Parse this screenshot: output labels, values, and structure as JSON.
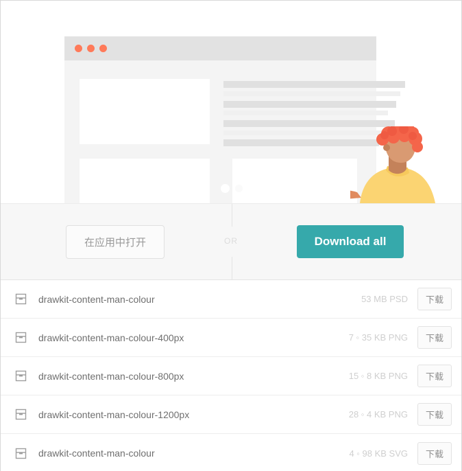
{
  "preview": {
    "illustration_name": "drawkit-content-man-colour-illustration",
    "browser_mockup_dots": [
      "dot-red-1",
      "dot-red-2",
      "dot-red-3"
    ],
    "dot_color": "#ff7a59",
    "character_hair_color": "#f4654a",
    "character_shirt_color": "#fbd472",
    "character_skin_color": "#d99a72"
  },
  "actions": {
    "open_in_app_label": "在应用中打开",
    "or_label": "OR",
    "download_all_label": "Download all",
    "accent_color": "#36a9ab"
  },
  "files": {
    "download_button_label": "下载",
    "items": [
      {
        "name": "drawkit-content-man-colour",
        "size": "53 MB",
        "format": "PSD",
        "size_label": "53 MB PSD"
      },
      {
        "name": "drawkit-content-man-colour-400px",
        "size": "7.35 KB",
        "format": "PNG",
        "size_label": "7 ◦ 35 KB PNG"
      },
      {
        "name": "drawkit-content-man-colour-800px",
        "size": "15.8 KB",
        "format": "PNG",
        "size_label": "15 ◦ 8 KB PNG"
      },
      {
        "name": "drawkit-content-man-colour-1200px",
        "size": "28.4 KB",
        "format": "PNG",
        "size_label": "28 ◦ 4 KB PNG"
      },
      {
        "name": "drawkit-content-man-colour",
        "size": "4.98 KB",
        "format": "SVG",
        "size_label": "4 ◦ 98 KB SVG"
      }
    ]
  }
}
